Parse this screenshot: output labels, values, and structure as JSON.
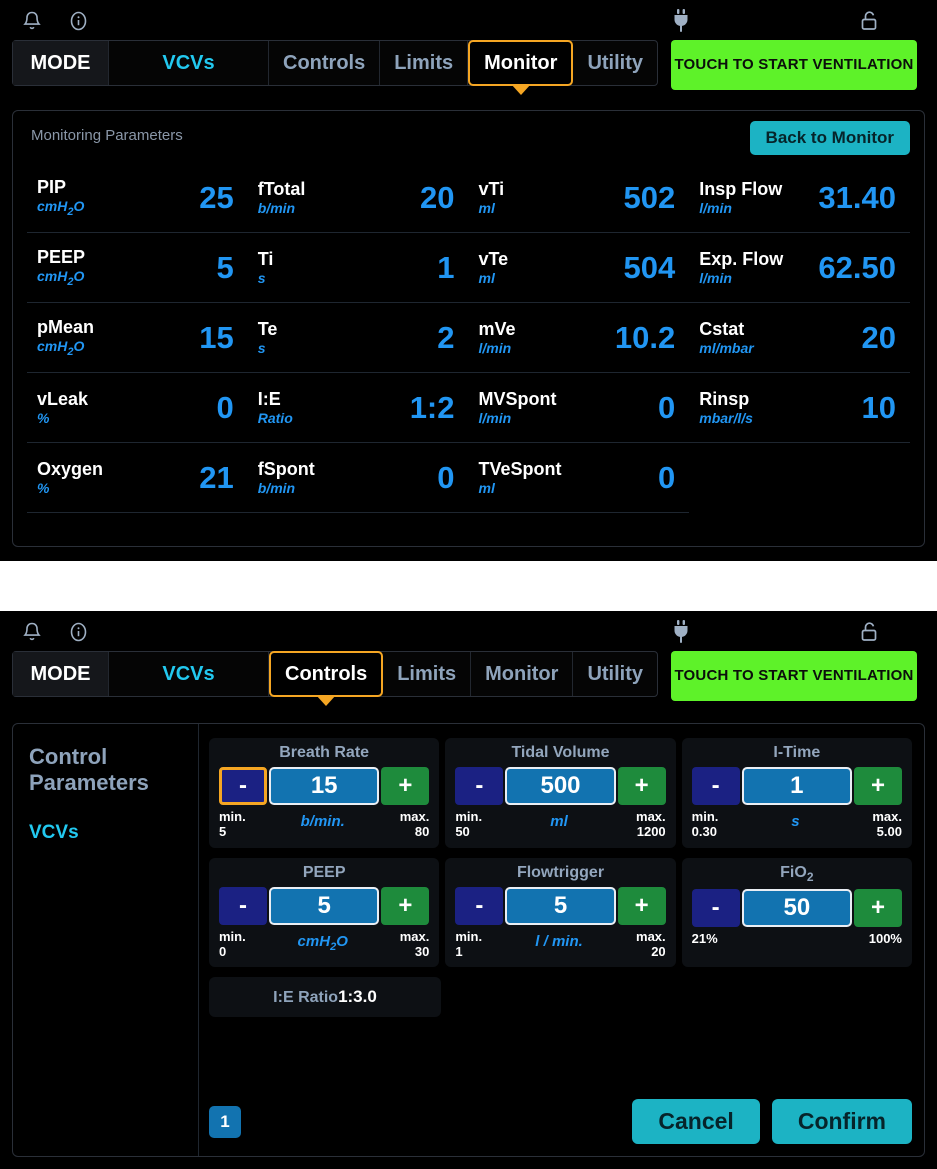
{
  "statusbar": {
    "bell_icon": "bell-icon",
    "info_icon": "info-circle-icon",
    "plug_icon": "power-plug-icon",
    "lock_icon": "unlocked-padlock-icon"
  },
  "screen_monitor": {
    "tabs": {
      "mode_label": "MODE",
      "mode_value": "VCVs",
      "items": [
        "Controls",
        "Limits",
        "Monitor",
        "Utility"
      ],
      "active": "Monitor"
    },
    "start_button": "TOUCH TO START VENTILATION",
    "panel_title": "Monitoring Parameters",
    "back_button": "Back to Monitor",
    "columns": [
      [
        {
          "name": "PIP",
          "unit": "cmH2O",
          "value": "25"
        },
        {
          "name": "PEEP",
          "unit": "cmH2O",
          "value": "5"
        },
        {
          "name": "pMean",
          "unit": "cmH2O",
          "value": "15"
        },
        {
          "name": "vLeak",
          "unit": "%",
          "value": "0"
        },
        {
          "name": "Oxygen",
          "unit": "%",
          "value": "21"
        }
      ],
      [
        {
          "name": "fTotal",
          "unit": "b/min",
          "value": "20"
        },
        {
          "name": "Ti",
          "unit": "s",
          "value": "1"
        },
        {
          "name": "Te",
          "unit": "s",
          "value": "2"
        },
        {
          "name": "I:E",
          "unit": "Ratio",
          "value": "1:2"
        },
        {
          "name": "fSpont",
          "unit": "b/min",
          "value": "0"
        }
      ],
      [
        {
          "name": "vTi",
          "unit": "ml",
          "value": "502"
        },
        {
          "name": "vTe",
          "unit": "ml",
          "value": "504"
        },
        {
          "name": "mVe",
          "unit": "l/min",
          "value": "10.2"
        },
        {
          "name": "MVSpont",
          "unit": "l/min",
          "value": "0"
        },
        {
          "name": "TVeSpont",
          "unit": "ml",
          "value": "0"
        }
      ],
      [
        {
          "name": "Insp Flow",
          "unit": "l/min",
          "value": "31.40"
        },
        {
          "name": "Exp. Flow",
          "unit": "l/min",
          "value": "62.50"
        },
        {
          "name": "Cstat",
          "unit": "ml/mbar",
          "value": "20"
        },
        {
          "name": "Rinsp",
          "unit": "mbar/l/s",
          "value": "10"
        }
      ]
    ]
  },
  "screen_controls": {
    "tabs": {
      "mode_label": "MODE",
      "mode_value": "VCVs",
      "items": [
        "Controls",
        "Limits",
        "Monitor",
        "Utility"
      ],
      "active": "Controls"
    },
    "start_button": "TOUCH TO START VENTILATION",
    "sidebar": {
      "title": "Control Parameters",
      "mode": "VCVs"
    },
    "cards": [
      {
        "title": "Breath Rate",
        "value": "15",
        "unit": "b/min.",
        "min_label": "min.\n5",
        "max_label": "max.\n80",
        "minus": "-",
        "plus": "+",
        "minus_focused": true
      },
      {
        "title": "Tidal Volume",
        "value": "500",
        "unit": "ml",
        "min_label": "min.\n50",
        "max_label": "max.\n1200",
        "minus": "-",
        "plus": "+",
        "minus_focused": false
      },
      {
        "title": "I-Time",
        "value": "1",
        "unit": "s",
        "min_label": "min.\n0.30",
        "max_label": "max.\n5.00",
        "minus": "-",
        "plus": "+",
        "minus_focused": false
      },
      {
        "title": "PEEP",
        "value": "5",
        "unit": "cmH2O",
        "min_label": "min.\n0",
        "max_label": "max.\n30",
        "minus": "-",
        "plus": "+",
        "minus_focused": false
      },
      {
        "title": "Flowtrigger",
        "value": "5",
        "unit": "l / min.",
        "min_label": "min.\n1",
        "max_label": "max.\n20",
        "minus": "-",
        "plus": "+",
        "minus_focused": false
      },
      {
        "title": "FiO2",
        "value": "50",
        "unit": "",
        "min_label": "21%",
        "max_label": "100%",
        "minus": "-",
        "plus": "+",
        "minus_focused": false
      }
    ],
    "ie_ratio": {
      "label": "I:E Ratio",
      "value": "1:3.0"
    },
    "page_indicator": "1",
    "cancel_button": "Cancel",
    "confirm_button": "Confirm"
  },
  "colors": {
    "accent_blue": "#2196f3",
    "mode_cyan": "#22c9f0",
    "active_tab_orange": "#f5a623",
    "start_green": "#5ef229",
    "teal_button": "#1cb3c4",
    "minus_navy": "#1b2183",
    "plus_green": "#1e8b3c",
    "value_blue": "#1273b0"
  }
}
